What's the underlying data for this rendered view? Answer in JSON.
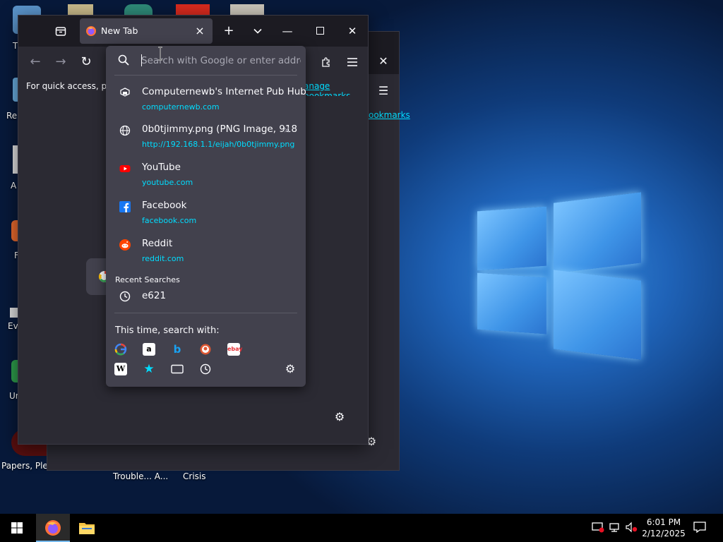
{
  "desktop": {
    "icons": [
      {
        "label": "T"
      },
      {
        "label": "Re"
      },
      {
        "label": "A"
      },
      {
        "label": "F"
      },
      {
        "label": "Eve"
      },
      {
        "label": "Un"
      },
      {
        "label": "Papers, Pleas"
      }
    ],
    "bottom_labels": [
      "Trouble... A...",
      "Crisis"
    ]
  },
  "browser": {
    "tab": {
      "title": "New Tab"
    },
    "bookmarks_bar": {
      "text": "For quick access, plac",
      "manage_link": "anage bookmarks"
    },
    "back_window": {
      "bookmarks_link": "ookmarks"
    }
  },
  "urlbar": {
    "placeholder": "Search with Google or enter address",
    "results": [
      {
        "title": "Computernewb's Internet Pub Hub!",
        "url": "computernewb.com",
        "icon": "computernewb-icon"
      },
      {
        "title": "0b0tjimmy.png (PNG Image, 918",
        "url": "http://192.168.1.1/eijah/0b0tjimmy.png",
        "icon": "globe-icon",
        "dismiss": "×"
      },
      {
        "title": "YouTube",
        "url": "youtube.com",
        "icon": "youtube-icon"
      },
      {
        "title": "Facebook",
        "url": "facebook.com",
        "icon": "facebook-icon"
      },
      {
        "title": "Reddit",
        "url": "reddit.com",
        "icon": "reddit-icon"
      }
    ],
    "recent_label": "Recent Searches",
    "recent": [
      {
        "text": "e621",
        "icon": "history-icon"
      }
    ],
    "search_with_label": "This time, search with:",
    "engines_row1": [
      "google",
      "amazon",
      "bing",
      "duckduckgo",
      "ebay"
    ],
    "engines_row2": [
      "wikipedia",
      "bookmarks",
      "tabs",
      "history"
    ]
  },
  "taskbar": {
    "time": "6:01 PM",
    "date": "2/12/2025",
    "colors": {
      "accent": "#76b9ed"
    }
  },
  "colors": {
    "panel": "#42414d",
    "toolbar": "#2b2a33",
    "tabstrip": "#1c1b22",
    "link": "#00ddff"
  }
}
